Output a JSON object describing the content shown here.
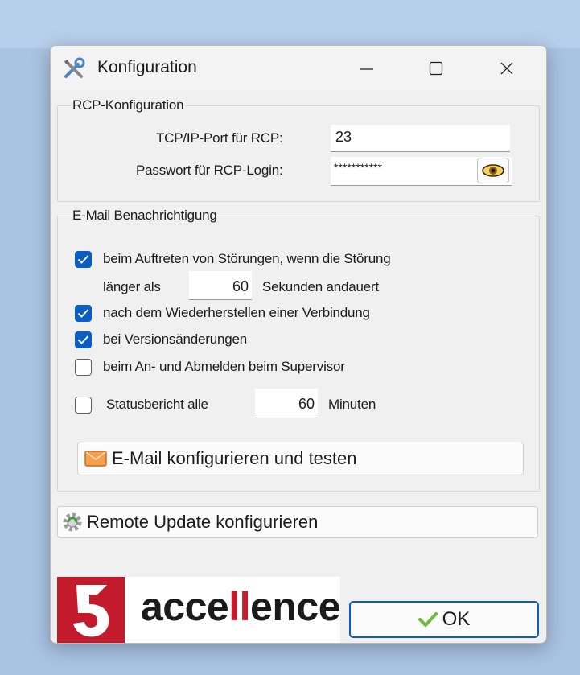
{
  "window": {
    "title": "Konfiguration",
    "controls": {
      "minimize": "—",
      "maximize": "☐",
      "close": "✕"
    }
  },
  "rcp": {
    "legend": "RCP-Konfiguration",
    "port_label": "TCP/IP-Port für RCP:",
    "port_value": "23",
    "password_label": "Passwort für RCP-Login:",
    "password_value": "***********"
  },
  "email": {
    "legend": "E-Mail Benachrichtigung",
    "opt_stoerung": {
      "checked": true,
      "label": "beim Auftreten von Störungen, wenn die Störung"
    },
    "laenger_als": "länger als",
    "seconds_value": "60",
    "seconds_suffix": "Sekunden andauert",
    "opt_verbindung": {
      "checked": true,
      "label": "nach dem Wiederherstellen einer Verbindung"
    },
    "opt_version": {
      "checked": true,
      "label": "bei Versionsänderungen"
    },
    "opt_supervisor": {
      "checked": false,
      "label": "beim An- und Abmelden beim Supervisor"
    },
    "opt_status": {
      "checked": false,
      "label": "Statusbericht alle"
    },
    "minutes_value": "60",
    "minutes_suffix": "Minuten",
    "config_button": "E-Mail konfigurieren und testen"
  },
  "remote_update_button": "Remote Update konfigurieren",
  "logo": {
    "prefix": "acce",
    "highlight": "ll",
    "suffix": "ence"
  },
  "ok_button": "OK",
  "colors": {
    "accent": "#0a5dc2",
    "brand_red": "#c31a2c",
    "window_bg": "#f0f0f0"
  }
}
